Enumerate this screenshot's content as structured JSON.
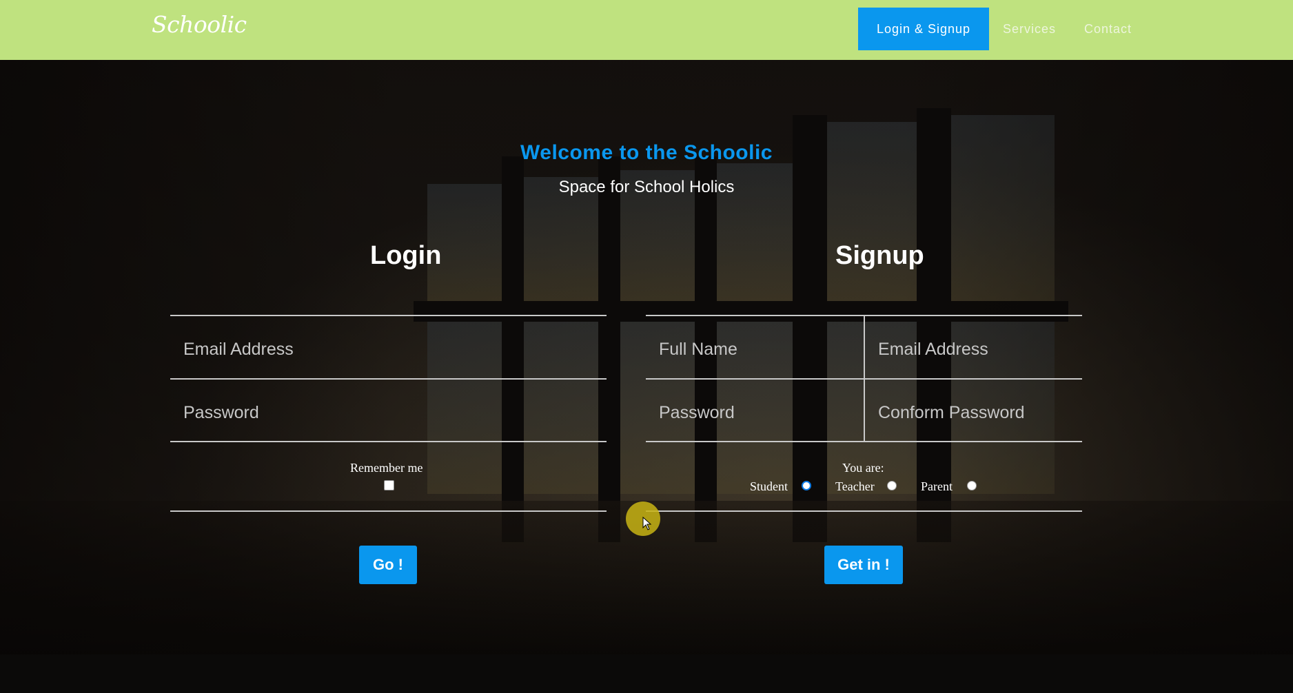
{
  "header": {
    "brand": "Schoolic",
    "nav": [
      {
        "label": "Login & Signup",
        "active": true
      },
      {
        "label": "Services",
        "active": false
      },
      {
        "label": "Contact",
        "active": false
      }
    ]
  },
  "hero": {
    "title": "Welcome to the Schoolic",
    "subtitle": "Space for School Holics"
  },
  "login": {
    "title": "Login",
    "email_placeholder": "Email Address",
    "password_placeholder": "Password",
    "remember_label": "Remember me",
    "remember_checked": false,
    "submit_label": "Go !"
  },
  "signup": {
    "title": "Signup",
    "fullname_placeholder": "Full Name",
    "email_placeholder": "Email Address",
    "password_placeholder": "Password",
    "confirm_placeholder": "Conform Password",
    "role_label": "You are:",
    "roles": [
      {
        "label": "Student",
        "checked": true
      },
      {
        "label": "Teacher",
        "checked": false
      },
      {
        "label": "Parent",
        "checked": false
      }
    ],
    "submit_label": "Get in !"
  },
  "colors": {
    "navbar": "#bfe27f",
    "accent": "#0a97ee",
    "cursor_highlight": "#c8b414"
  },
  "icons": {
    "cursor": "mouse-pointer-icon"
  }
}
